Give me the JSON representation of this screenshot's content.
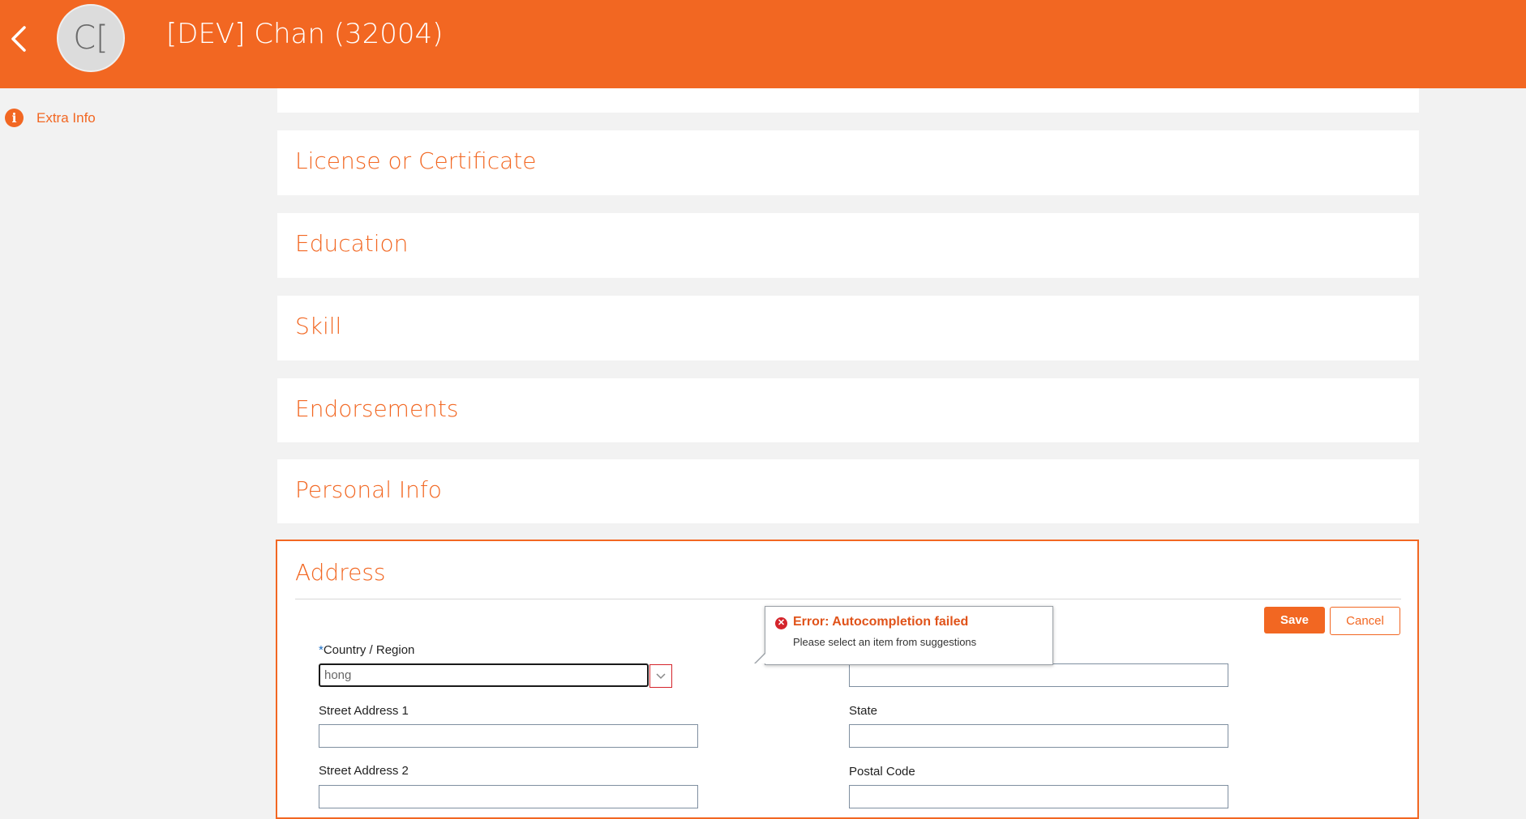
{
  "header": {
    "title": "[DEV] Chan (32004)",
    "avatar_initials": "C[",
    "back_icon": "chevron-left-icon",
    "color": "#f26722"
  },
  "sidebar": {
    "items": [
      {
        "label": "Extra Info",
        "icon": "info-icon"
      }
    ]
  },
  "sections": [
    {
      "title": "License or Certificate"
    },
    {
      "title": "Education"
    },
    {
      "title": "Skill"
    },
    {
      "title": "Endorsements"
    },
    {
      "title": "Personal Info"
    }
  ],
  "address": {
    "title": "Address",
    "save_label": "Save",
    "cancel_label": "Cancel",
    "fields": {
      "country_required_mark": "*",
      "country_label": "Country / Region",
      "country_value": "hong",
      "street1_label": "Street Address 1",
      "street2_label": "Street Address 2",
      "state_label": "State",
      "postal_label": "Postal Code"
    }
  },
  "error": {
    "title": "Error: Autocompletion failed",
    "message": "Please select an item from suggestions",
    "icon": "error-x-icon",
    "color": "#d4242b"
  }
}
